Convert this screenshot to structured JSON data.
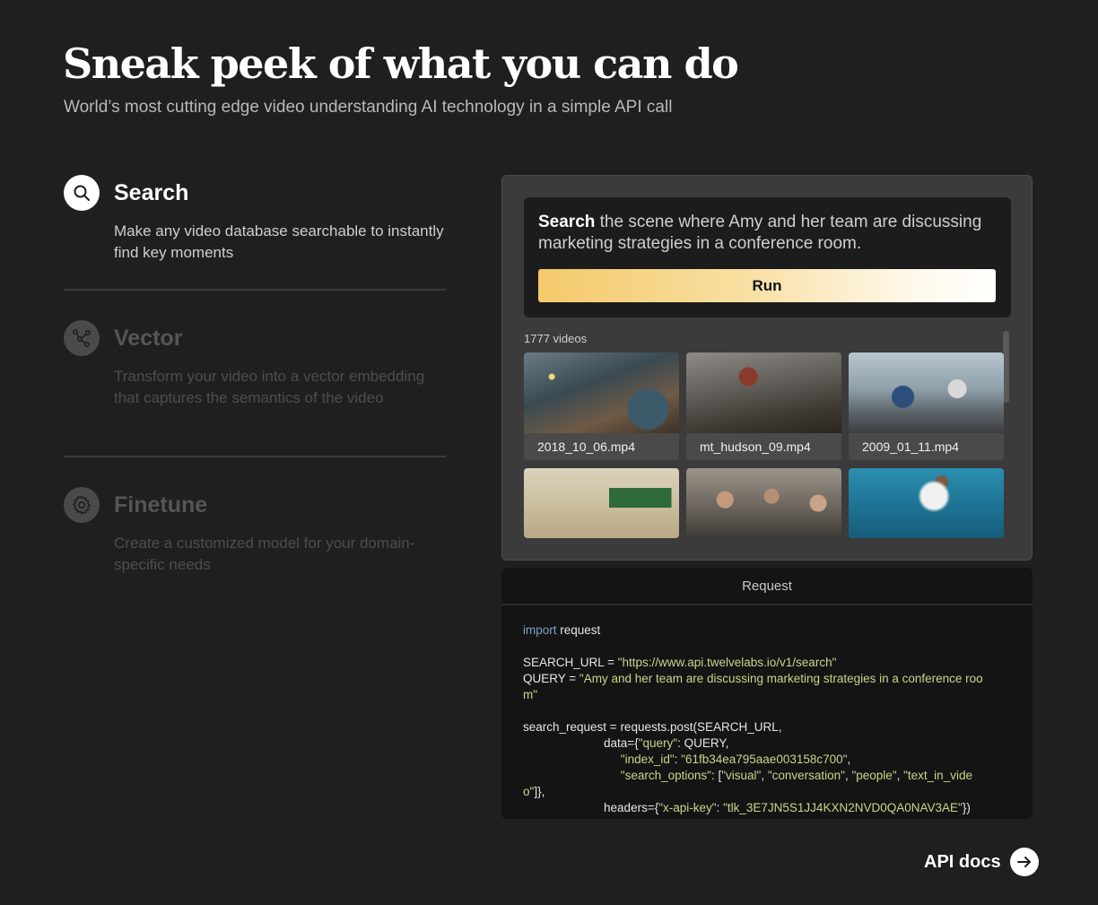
{
  "header": {
    "title": "Sneak peek of what you can do",
    "subtitle": "World’s most cutting edge video understanding AI technology in a simple API call"
  },
  "features": [
    {
      "icon": "search-icon",
      "title": "Search",
      "description": "Make any video database searchable to instantly find key moments",
      "active": true
    },
    {
      "icon": "vector-icon",
      "title": "Vector",
      "description": "Transform your video into a vector embedding that captures the semantics of the video",
      "active": false
    },
    {
      "icon": "gear-icon",
      "title": "Finetune",
      "description": "Create a customized model for your domain-specific needs",
      "active": false
    }
  ],
  "demo": {
    "query_keyword": "Search",
    "query_text": " the scene where Amy and her team are discussing marketing strategies in a conference room.",
    "run_label": "Run",
    "video_count": "1777 videos",
    "videos": [
      {
        "filename": "2018_10_06.mp4"
      },
      {
        "filename": "mt_hudson_09.mp4"
      },
      {
        "filename": "2009_01_11.mp4"
      },
      {
        "filename": ""
      },
      {
        "filename": ""
      },
      {
        "filename": ""
      }
    ]
  },
  "request": {
    "title": "Request",
    "import_kw": "import",
    "import_mod": " request",
    "search_url_var": "SEARCH_URL = ",
    "search_url_val": "\"https://www.api.twelvelabs.io/v1/search\"",
    "query_var": "QUERY = ",
    "query_val_1": "\"Amy and her team are discussing marketing strategies in a conference roo",
    "query_val_2": "m\"",
    "req_line": "search_request = requests.post(SEARCH_URL,",
    "data_prefix": "data={",
    "data_key_query": "\"query\"",
    "data_query_rest": ": QUERY,",
    "index_key": "\"index_id\"",
    "index_sep": ": ",
    "index_val": "\"61fb34ea795aae003158c700\"",
    "index_end": ",",
    "opts_key": "\"search_options\"",
    "opts_sep": ": [",
    "opt_visual": "\"visual\"",
    "opt_conv": "\"conversation\"",
    "opt_people": "\"people\"",
    "opt_text_1": "\"text_in_vide",
    "opt_text_2": "o\"",
    "opts_end": "]},",
    "headers_prefix": "headers={",
    "headers_key": "\"x-api-key\"",
    "headers_sep": ": ",
    "headers_val": "\"tlk_3E7JN5S1JJ4KXN2NVD0QA0NAV3AE\"",
    "headers_end": "})"
  },
  "footer": {
    "api_docs_label": "API docs",
    "api_docs_icon": "arrow-right-icon"
  },
  "colors": {
    "background": "#1f1f1f",
    "accent_gold": "#f4c96a",
    "code_string": "#c9d58a",
    "code_keyword": "#7aa2c8"
  }
}
